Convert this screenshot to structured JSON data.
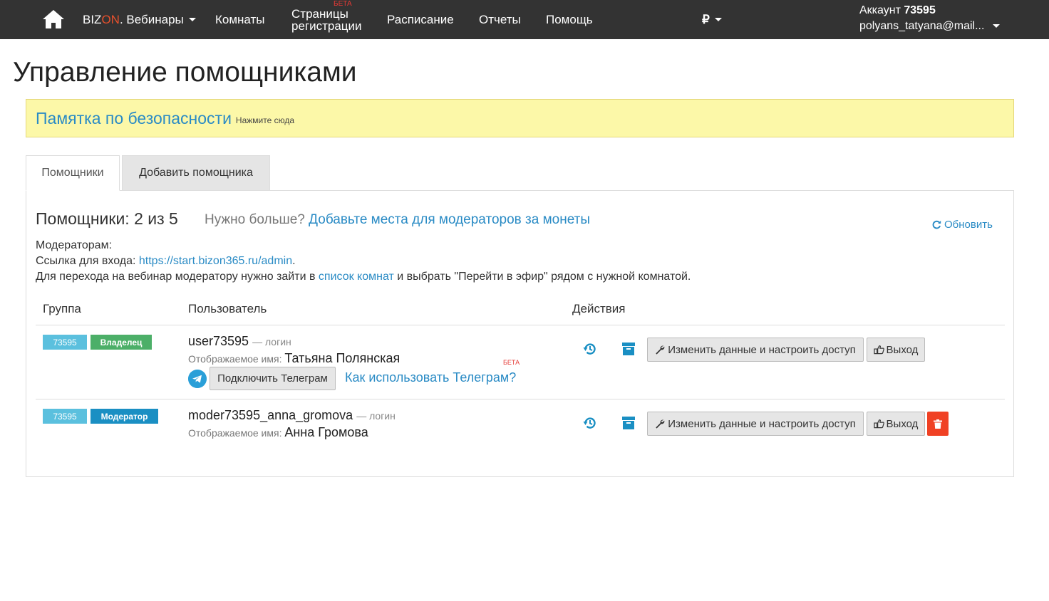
{
  "nav": {
    "brand_prefix": "BIZ",
    "brand_on": "ON",
    "brand_suffix": ". Вебинары",
    "rooms": "Комнаты",
    "reg_line1": "Страницы",
    "reg_line2": "регистрации",
    "reg_beta": "БЕТА",
    "schedule": "Расписание",
    "reports": "Отчеты",
    "help": "Помощь",
    "currency": "₽",
    "account_label": "Аккаунт",
    "account_number": "73595",
    "account_email": "polyans_tatyana@mail..."
  },
  "page": {
    "title": "Управление помощниками"
  },
  "alert": {
    "link": "Памятка по безопасности",
    "small": "Нажмите сюда",
    "bg_color": "#fcf8a8"
  },
  "tabs": [
    {
      "label": "Помощники",
      "active": true
    },
    {
      "label": "Добавить помощника",
      "active": false
    }
  ],
  "summary": {
    "count_title": "Помощники: 2 из 5",
    "need_more": "Нужно больше?",
    "buy_link": "Добавьте места для модераторов за монеты",
    "refresh": "Обновить"
  },
  "info": {
    "line1": "Модераторам:",
    "link_label": "Ссылка для входа:",
    "link_url": "https://start.bizon365.ru/admin",
    "link_dot": ".",
    "line3_pre": "Для перехода на вебинар модератору нужно зайти в",
    "line3_link": "список комнат",
    "line3_post": "и выбрать \"Перейти в эфир\" рядом с нужной комнатой."
  },
  "table": {
    "headers": {
      "group": "Группа",
      "user": "Пользователь",
      "actions": "Действия"
    },
    "rows": [
      {
        "account": "73595",
        "role": "Владелец",
        "username": "user73595",
        "login_suffix": "— логин",
        "display_label": "Отображаемое имя:",
        "display_name": "Татьяна Полянская",
        "telegram_button": "Подключить Телеграм",
        "telegram_help": "Как использовать Телеграм?",
        "telegram_beta": "БЕТА",
        "edit_button": "Изменить данные и настроить доступ",
        "logout_button": "Выход"
      },
      {
        "account": "73595",
        "role": "Модератор",
        "username": "moder73595_anna_gromova",
        "login_suffix": "— логин",
        "display_label": "Отображаемое имя:",
        "display_name": "Анна Громова",
        "edit_button": "Изменить данные и настроить доступ",
        "logout_button": "Выход"
      }
    ]
  },
  "colors": {
    "navbar": "#333333",
    "link": "#2a8bc5",
    "owner_badge": "#4caf68",
    "moderator_badge": "#1a8fc3",
    "account_badge": "#5bc0de",
    "delete": "#f04124"
  }
}
